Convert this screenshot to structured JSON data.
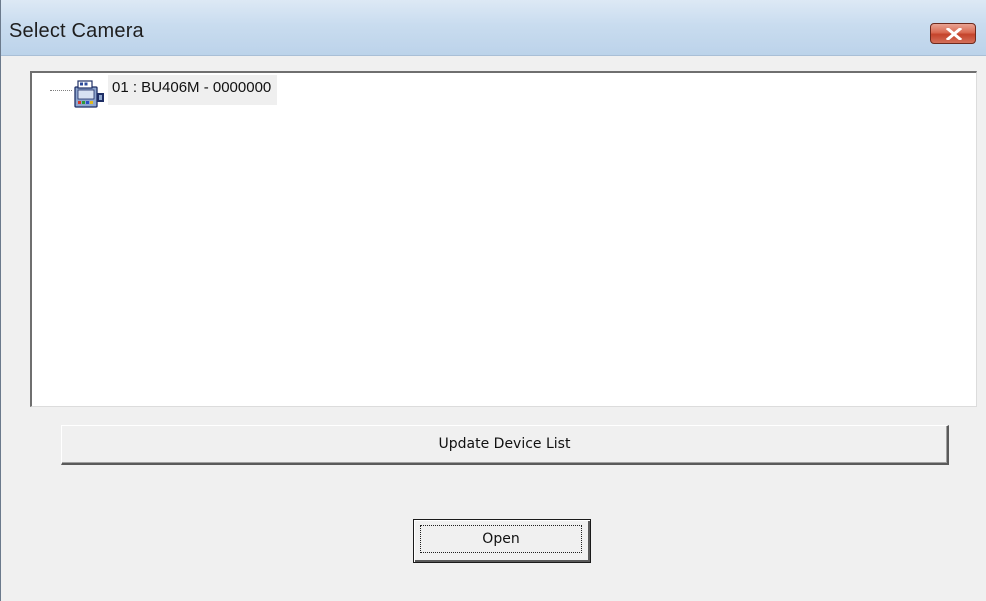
{
  "window": {
    "title": "Select Camera",
    "close_icon": "close-icon"
  },
  "device_tree": {
    "items": [
      {
        "label": "01 : BU406M - 0000000",
        "icon": "camera-icon"
      }
    ]
  },
  "buttons": {
    "update_label": "Update Device List",
    "open_label": "Open"
  }
}
